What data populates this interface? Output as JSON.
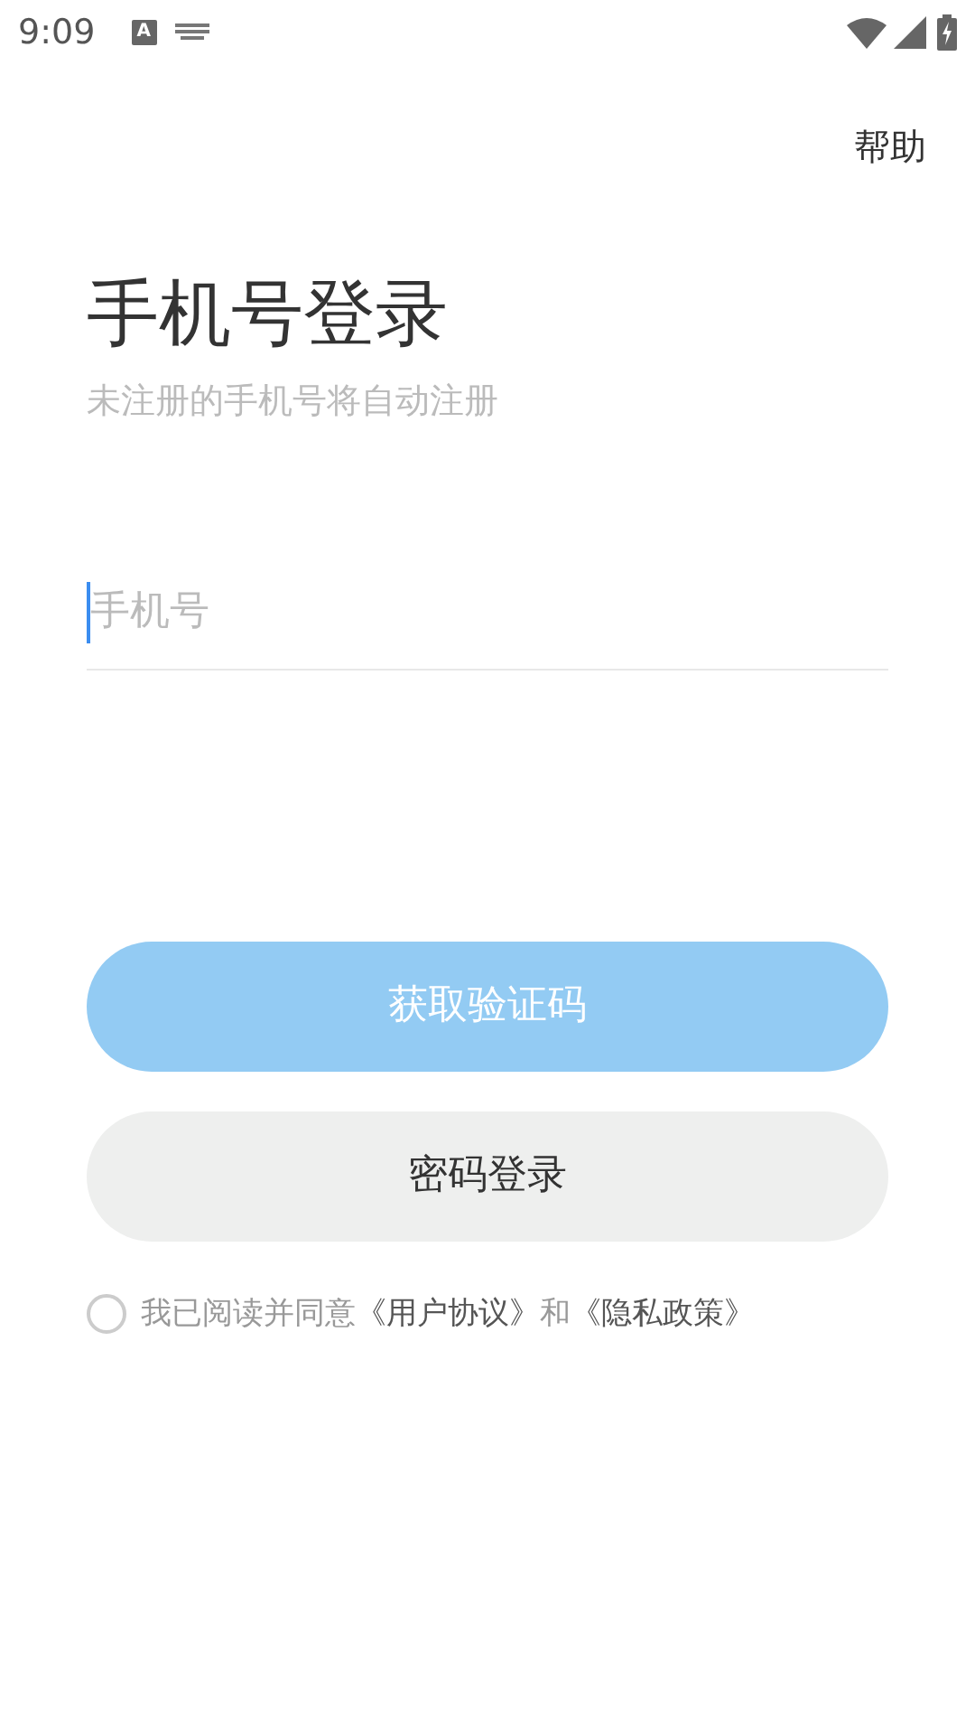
{
  "status_bar": {
    "time": "9:09",
    "ime_label": "A"
  },
  "header": {
    "help": "帮助"
  },
  "title": "手机号登录",
  "subtitle": "未注册的手机号将自动注册",
  "phone_field": {
    "placeholder": "手机号",
    "focused": true
  },
  "buttons": [
    {
      "label": "获取验证码",
      "kind": "primary",
      "disabled": true
    },
    {
      "label": "密码登录",
      "kind": "secondary",
      "disabled": false
    }
  ],
  "agreement": {
    "checked": false,
    "text": "我已阅读并同意",
    "links": [
      "《用户协议》",
      "《隐私政策》"
    ],
    "conjunction": "和"
  }
}
